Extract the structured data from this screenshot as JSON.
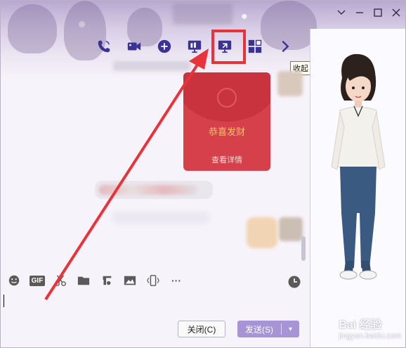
{
  "window": {
    "controls": [
      "chevron-down",
      "minimize",
      "maximize",
      "close"
    ]
  },
  "toolbar": {
    "icons": [
      "phone-icon",
      "video-call-icon",
      "add-chat-icon",
      "screen-share-icon",
      "remote-desktop-icon",
      "apps-icon",
      "chevron-right-icon"
    ],
    "tooltip": "收起"
  },
  "chat": {
    "red_packet": {
      "wish": "恭喜发财",
      "detail": "查看详情"
    }
  },
  "input_toolbar": {
    "gif_label": "GIF",
    "more_label": "···"
  },
  "buttons": {
    "close": "关闭(C)",
    "send": "发送(S)",
    "send_dropdown": "▾"
  },
  "watermark": {
    "main": "Bai 经验",
    "sub": "jingyan.baidu.com"
  },
  "colors": {
    "accent": "#a694d6",
    "icon": "#3c3294",
    "highlight": "#e8333a",
    "red_packet": "#d5404a"
  }
}
